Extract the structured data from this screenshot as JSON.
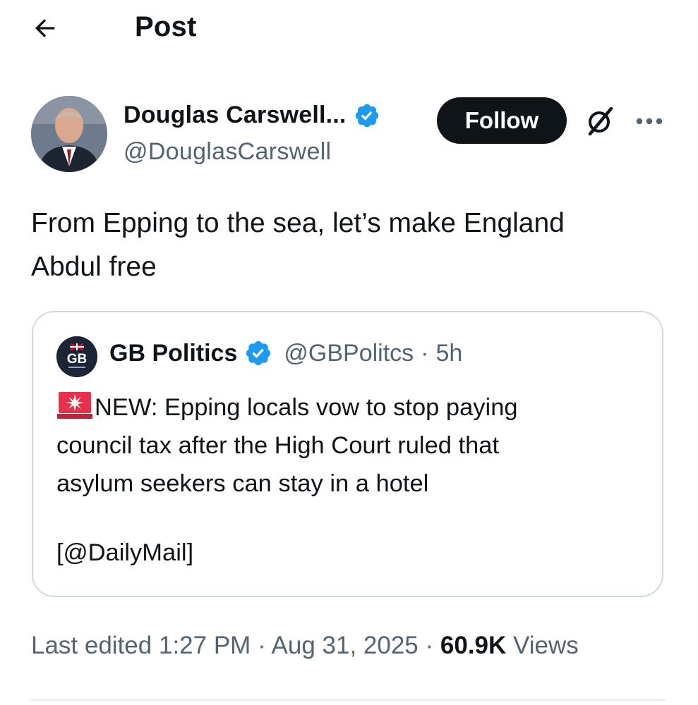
{
  "header": {
    "title": "Post",
    "back_icon": "arrow-left-icon"
  },
  "author": {
    "name": "Douglas Carswell...",
    "handle": "@DouglasCarswell",
    "verified": true,
    "follow_label": "Follow"
  },
  "tweet": {
    "text_line1": "From Epping to the sea, let’s make England",
    "text_line2": "Abdul free"
  },
  "quote": {
    "name": "GB Politics",
    "verified": true,
    "handle": "@GBPolitcs",
    "separator": "·",
    "time": "5h",
    "avatar_text": "GB",
    "body_line1": "NEW: Epping locals vow to stop paying",
    "body_line2": "council tax after the High Court ruled that",
    "body_line3": "asylum seekers can stay in a hotel",
    "source": "[@DailyMail]"
  },
  "stats": {
    "edited_prefix": "Last edited",
    "time": "1:27 PM",
    "separator": "·",
    "date": "Aug 31, 2025",
    "views_count": "60.9K",
    "views_label": "Views"
  },
  "colors": {
    "text_primary": "#0f1419",
    "text_secondary": "#536471",
    "verified_blue": "#1d9bf0",
    "border": "#cfd9de",
    "siren_red": "#e8304a"
  }
}
